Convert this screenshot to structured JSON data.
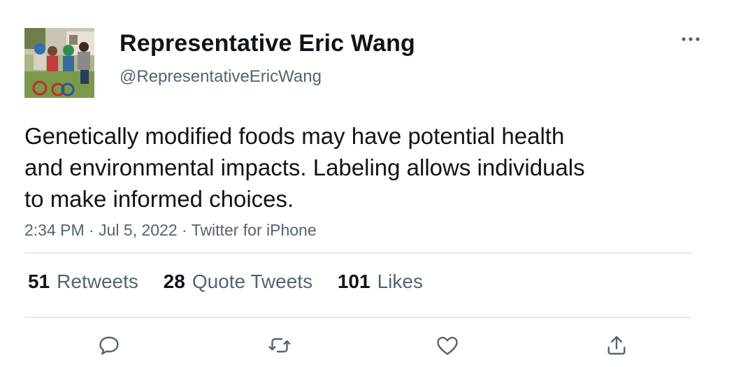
{
  "author": {
    "display_name": "Representative Eric Wang",
    "handle": "@RepresentativeEricWang"
  },
  "tweet": {
    "lines": [
      "Genetically modified foods may have potential health",
      "and environmental impacts. Labeling allows individuals",
      "to make informed choices."
    ],
    "time": "2:34 PM",
    "date": "Jul 5, 2022",
    "source": "Twitter for iPhone",
    "separator": " · "
  },
  "stats": {
    "retweets": {
      "count": "51",
      "label": "Retweets"
    },
    "quote_tweets": {
      "count": "28",
      "label": "Quote Tweets"
    },
    "likes": {
      "count": "101",
      "label": "Likes"
    }
  },
  "icons": {
    "more": "more-horizontal-icon",
    "reply": "reply-icon",
    "retweet": "retweet-icon",
    "like": "heart-icon",
    "share": "share-icon"
  },
  "colors": {
    "text": "#0f1419",
    "secondary": "#536471",
    "divider": "#e6e9ec"
  }
}
